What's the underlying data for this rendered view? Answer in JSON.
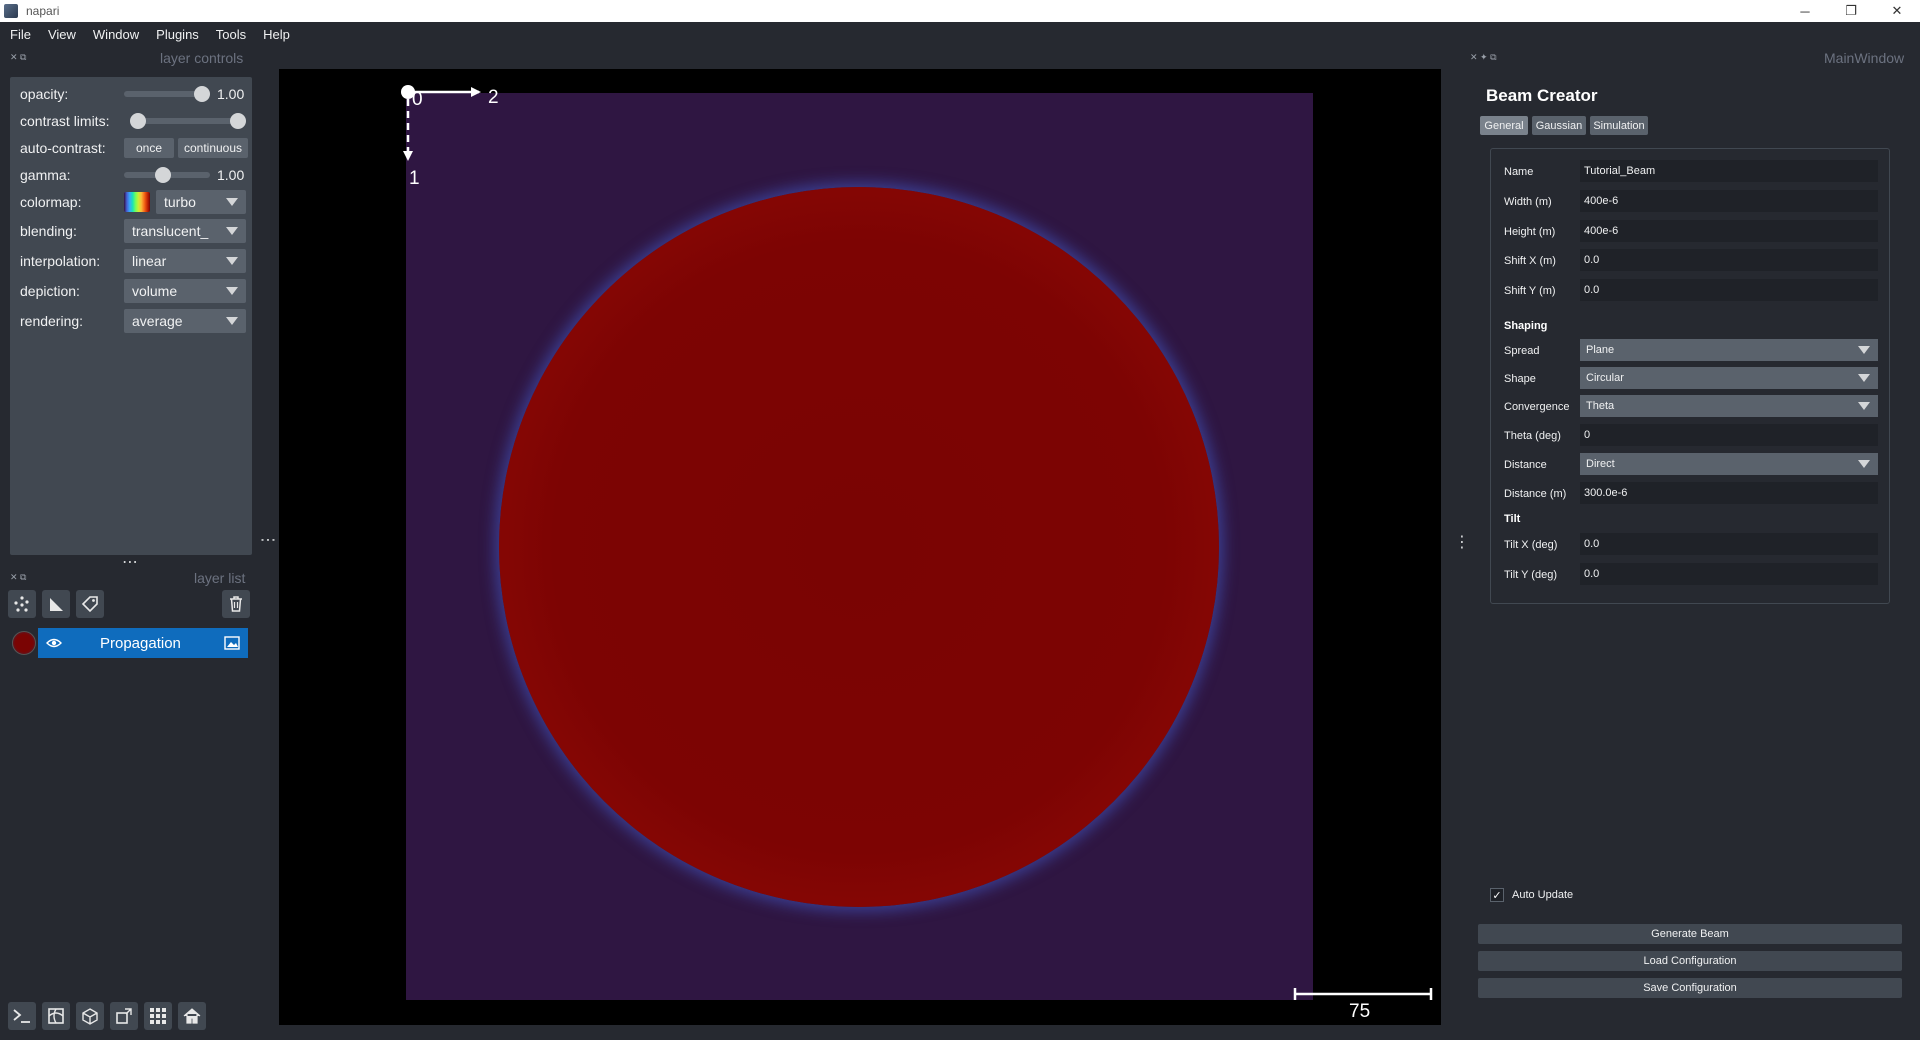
{
  "window": {
    "title": "napari",
    "buttons": [
      "─",
      "❐",
      "✕"
    ]
  },
  "menu": [
    "File",
    "View",
    "Window",
    "Plugins",
    "Tools",
    "Help"
  ],
  "layer_controls": {
    "title": "layer controls",
    "opacity": {
      "label": "opacity:",
      "value": "1.00",
      "level": 1.0
    },
    "contrast_limits": {
      "label": "contrast limits:",
      "low": 0.0,
      "high": 1.0
    },
    "auto_contrast": {
      "label": "auto-contrast:",
      "once": "once",
      "continuous": "continuous"
    },
    "gamma": {
      "label": "gamma:",
      "value": "1.00",
      "level": 0.5
    },
    "colormap": {
      "label": "colormap:",
      "value": "turbo"
    },
    "blending": {
      "label": "blending:",
      "value": "translucent_"
    },
    "interpolation": {
      "label": "interpolation:",
      "value": "linear"
    },
    "depiction": {
      "label": "depiction:",
      "value": "volume"
    },
    "rendering": {
      "label": "rendering:",
      "value": "average"
    }
  },
  "layer_list": {
    "title": "layer list",
    "layers": [
      {
        "name": "Propagation",
        "visible": true
      }
    ]
  },
  "canvas": {
    "axis_labels": {
      "x_origin": "0",
      "x_axis": "2",
      "y_axis": "1"
    },
    "scale_bar": "75"
  },
  "main_window": {
    "title": "MainWindow",
    "panel_title": "Beam Creator",
    "tabs": [
      "General",
      "Gaussian",
      "Simulation"
    ],
    "active_tab": "General",
    "fields": {
      "name": {
        "label": "Name",
        "value": "Tutorial_Beam"
      },
      "width": {
        "label": "Width (m)",
        "value": "400e-6"
      },
      "height": {
        "label": "Height (m)",
        "value": "400e-6"
      },
      "shift_x": {
        "label": "Shift X (m)",
        "value": "0.0"
      },
      "shift_y": {
        "label": "Shift Y (m)",
        "value": "0.0"
      }
    },
    "shaping": {
      "heading": "Shaping",
      "spread": {
        "label": "Spread",
        "value": "Plane"
      },
      "shape": {
        "label": "Shape",
        "value": "Circular"
      },
      "convergence": {
        "label": "Convergence",
        "value": "Theta"
      },
      "theta": {
        "label": "Theta (deg)",
        "value": "0"
      },
      "distance_mode": {
        "label": "Distance",
        "value": "Direct"
      },
      "distance": {
        "label": "Distance (m)",
        "value": "300.0e-6"
      }
    },
    "tilt": {
      "heading": "Tilt",
      "tilt_x": {
        "label": "Tilt X (deg)",
        "value": "0.0"
      },
      "tilt_y": {
        "label": "Tilt Y (deg)",
        "value": "0.0"
      }
    },
    "auto_update": {
      "label": "Auto Update",
      "checked": true
    },
    "actions": {
      "generate": "Generate Beam",
      "load": "Load Configuration",
      "save": "Save Configuration"
    }
  },
  "colors": {
    "background": "#262930",
    "panel": "#414851",
    "selection": "#0f6cbd",
    "beam_core": "#7a0403",
    "image_bg": "#2f1642"
  },
  "icons": {
    "points": "new-points-icon",
    "shapes": "new-shapes-icon",
    "labels": "new-labels-icon",
    "delete": "trash-icon",
    "console": "console-icon",
    "ndisplay": "ndisplay-icon",
    "roll": "roll-axes-icon",
    "transpose": "transpose-icon",
    "grid": "grid-icon",
    "home": "home-icon"
  }
}
